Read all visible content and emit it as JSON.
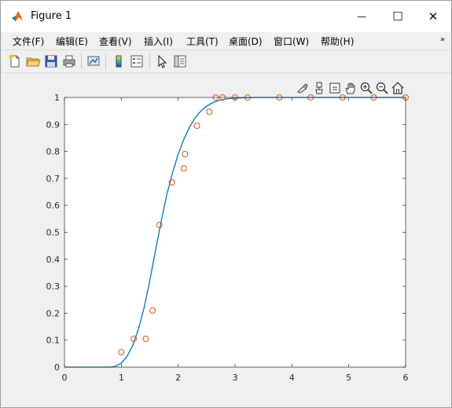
{
  "window": {
    "title": "Figure 1",
    "controls": {
      "minimize": "—",
      "maximize": "☐",
      "close": "✕"
    }
  },
  "menu": {
    "items": [
      "文件(F)",
      "编辑(E)",
      "查看(V)",
      "插入(I)",
      "工具(T)",
      "桌面(D)",
      "窗口(W)",
      "帮助(H)"
    ],
    "overflow_icon": "chevron-double-icon"
  },
  "toolbar": {
    "icons": [
      "new-figure-icon",
      "open-file-icon",
      "save-icon",
      "print-icon",
      "link-plot-icon",
      "insert-colorbar-icon",
      "insert-legend-icon",
      "select-pointer-icon",
      "property-inspector-icon"
    ]
  },
  "axes_toolbar": {
    "icons": [
      "brush-icon",
      "data-tips-icon",
      "export-icon",
      "pan-hand-icon",
      "zoom-in-icon",
      "zoom-out-icon",
      "home-icon"
    ]
  },
  "colors": {
    "fit_line": "#0072bd",
    "markers": "#d95319",
    "axes": "#262626"
  },
  "chart_data": {
    "type": "scatter",
    "title": "",
    "xlabel": "",
    "ylabel": "",
    "xlim": [
      0,
      6
    ],
    "ylim": [
      0,
      1
    ],
    "x_ticks": [
      "0",
      "1",
      "2",
      "3",
      "4",
      "5",
      "6"
    ],
    "y_ticks": [
      "0",
      "0.1",
      "0.2",
      "0.3",
      "0.4",
      "0.5",
      "0.6",
      "0.7",
      "0.8",
      "0.9",
      "1"
    ],
    "grid": false,
    "series": [
      {
        "style": "circle-markers",
        "x": [
          1.0,
          1.22,
          1.43,
          1.55,
          1.67,
          1.89,
          2.1,
          2.12,
          2.33,
          2.55,
          2.66,
          2.78,
          3.0,
          3.22,
          3.78,
          4.33,
          4.89,
          5.44,
          6.0
        ],
        "y": [
          0.055,
          0.105,
          0.105,
          0.21,
          0.527,
          0.685,
          0.737,
          0.79,
          0.895,
          0.947,
          1.0,
          1.0,
          1.0,
          1.0,
          1.0,
          1.0,
          1.0,
          1.0,
          1.0
        ]
      },
      {
        "style": "line",
        "x": [
          0.0,
          0.8,
          0.9,
          1.0,
          1.1,
          1.2,
          1.3,
          1.4,
          1.5,
          1.6,
          1.7,
          1.8,
          1.9,
          2.0,
          2.1,
          2.2,
          2.3,
          2.4,
          2.5,
          2.6,
          2.7,
          2.8,
          2.9,
          3.0,
          3.2,
          3.4,
          3.6,
          4.0,
          5.0,
          6.0
        ],
        "y": [
          0.0,
          0.0,
          0.003,
          0.015,
          0.04,
          0.08,
          0.14,
          0.22,
          0.32,
          0.43,
          0.54,
          0.64,
          0.72,
          0.79,
          0.845,
          0.89,
          0.925,
          0.95,
          0.968,
          0.98,
          0.988,
          0.993,
          0.996,
          0.998,
          0.999,
          1.0,
          1.0,
          1.0,
          1.0,
          1.0
        ]
      }
    ]
  }
}
